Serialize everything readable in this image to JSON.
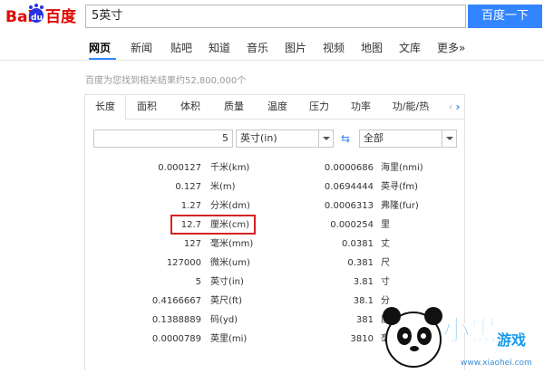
{
  "logo": {
    "part1": "Bai",
    "part2": "du",
    "part3": "百度"
  },
  "search": {
    "query": "5英寸",
    "button_label": "百度一下"
  },
  "nav": {
    "items": [
      "网页",
      "新闻",
      "贴吧",
      "知道",
      "音乐",
      "图片",
      "视频",
      "地图",
      "文库",
      "更多»"
    ],
    "active": "网页"
  },
  "result_count": "百度为您找到相关结果约52,800,000个",
  "converter": {
    "tabs": [
      "长度",
      "面积",
      "体积",
      "质量",
      "温度",
      "压力",
      "功率",
      "功/能/热"
    ],
    "active_tab": "长度",
    "input_value": "5",
    "from_unit": "英寸(in)",
    "to_unit": "全部",
    "left_rows": [
      {
        "value": "0.000127",
        "unit": "千米(km)"
      },
      {
        "value": "0.127",
        "unit": "米(m)"
      },
      {
        "value": "1.27",
        "unit": "分米(dm)"
      },
      {
        "value": "12.7",
        "unit": "厘米(cm)"
      },
      {
        "value": "127",
        "unit": "毫米(mm)"
      },
      {
        "value": "127000",
        "unit": "微米(um)"
      },
      {
        "value": "5",
        "unit": "英寸(in)"
      },
      {
        "value": "0.4166667",
        "unit": "英尺(ft)"
      },
      {
        "value": "0.1388889",
        "unit": "码(yd)"
      },
      {
        "value": "0.0000789",
        "unit": "英里(mi)"
      }
    ],
    "right_rows": [
      {
        "value": "0.0000686",
        "unit": "海里(nmi)"
      },
      {
        "value": "0.0694444",
        "unit": "英寻(fm)"
      },
      {
        "value": "0.0006313",
        "unit": "弗隆(fur)"
      },
      {
        "value": "0.000254",
        "unit": "里"
      },
      {
        "value": "0.0381",
        "unit": "丈"
      },
      {
        "value": "0.381",
        "unit": "尺"
      },
      {
        "value": "3.81",
        "unit": "寸"
      },
      {
        "value": "38.1",
        "unit": "分"
      },
      {
        "value": "381",
        "unit": "厘"
      },
      {
        "value": "3810",
        "unit": "毫"
      }
    ]
  },
  "watermark": {
    "site": "www.xiaohei.com",
    "text1": "小黑",
    "text2": "游戏"
  },
  "colors": {
    "accent": "#3385ff",
    "highlight": "#d62222",
    "logo_red": "#e10601",
    "logo_blue": "#2932e1"
  }
}
